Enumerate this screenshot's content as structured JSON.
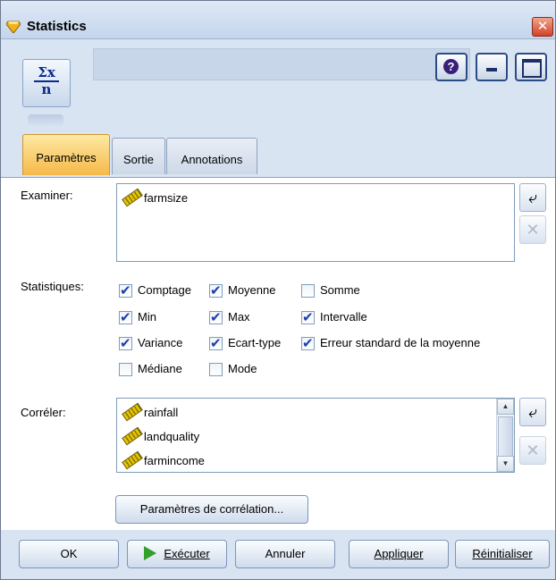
{
  "window": {
    "title": "Statistics"
  },
  "header": {
    "node_symbol_top": "Σx",
    "node_symbol_bottom": "n",
    "help_label": "?"
  },
  "tabs": [
    {
      "label": "Paramètres",
      "active": true
    },
    {
      "label": "Sortie",
      "active": false
    },
    {
      "label": "Annotations",
      "active": false
    }
  ],
  "examine": {
    "label": "Examiner:",
    "fields": [
      "farmsize"
    ]
  },
  "statistics": {
    "label": "Statistiques:",
    "options": [
      {
        "label": "Comptage",
        "checked": true
      },
      {
        "label": "Moyenne",
        "checked": true
      },
      {
        "label": "Somme",
        "checked": false
      },
      {
        "label": "Min",
        "checked": true
      },
      {
        "label": "Max",
        "checked": true
      },
      {
        "label": "Intervalle",
        "checked": true
      },
      {
        "label": "Variance",
        "checked": true
      },
      {
        "label": "Ecart-type",
        "checked": true
      },
      {
        "label": "Erreur standard de la moyenne",
        "checked": true
      },
      {
        "label": "Médiane",
        "checked": false
      },
      {
        "label": "Mode",
        "checked": false
      }
    ]
  },
  "correlate": {
    "label": "Corréler:",
    "fields": [
      "rainfall",
      "landquality",
      "farmincome"
    ],
    "settings_button": "Paramètres de corrélation..."
  },
  "buttons": {
    "ok": "OK",
    "run": "Exécuter",
    "cancel": "Annuler",
    "apply": "Appliquer",
    "reset": "Réinitialiser"
  },
  "colors": {
    "active_tab": "#f6b94a",
    "window_bg": "#d9e4f2",
    "check": "#1a3fb0",
    "run_icon": "#33a02c"
  }
}
